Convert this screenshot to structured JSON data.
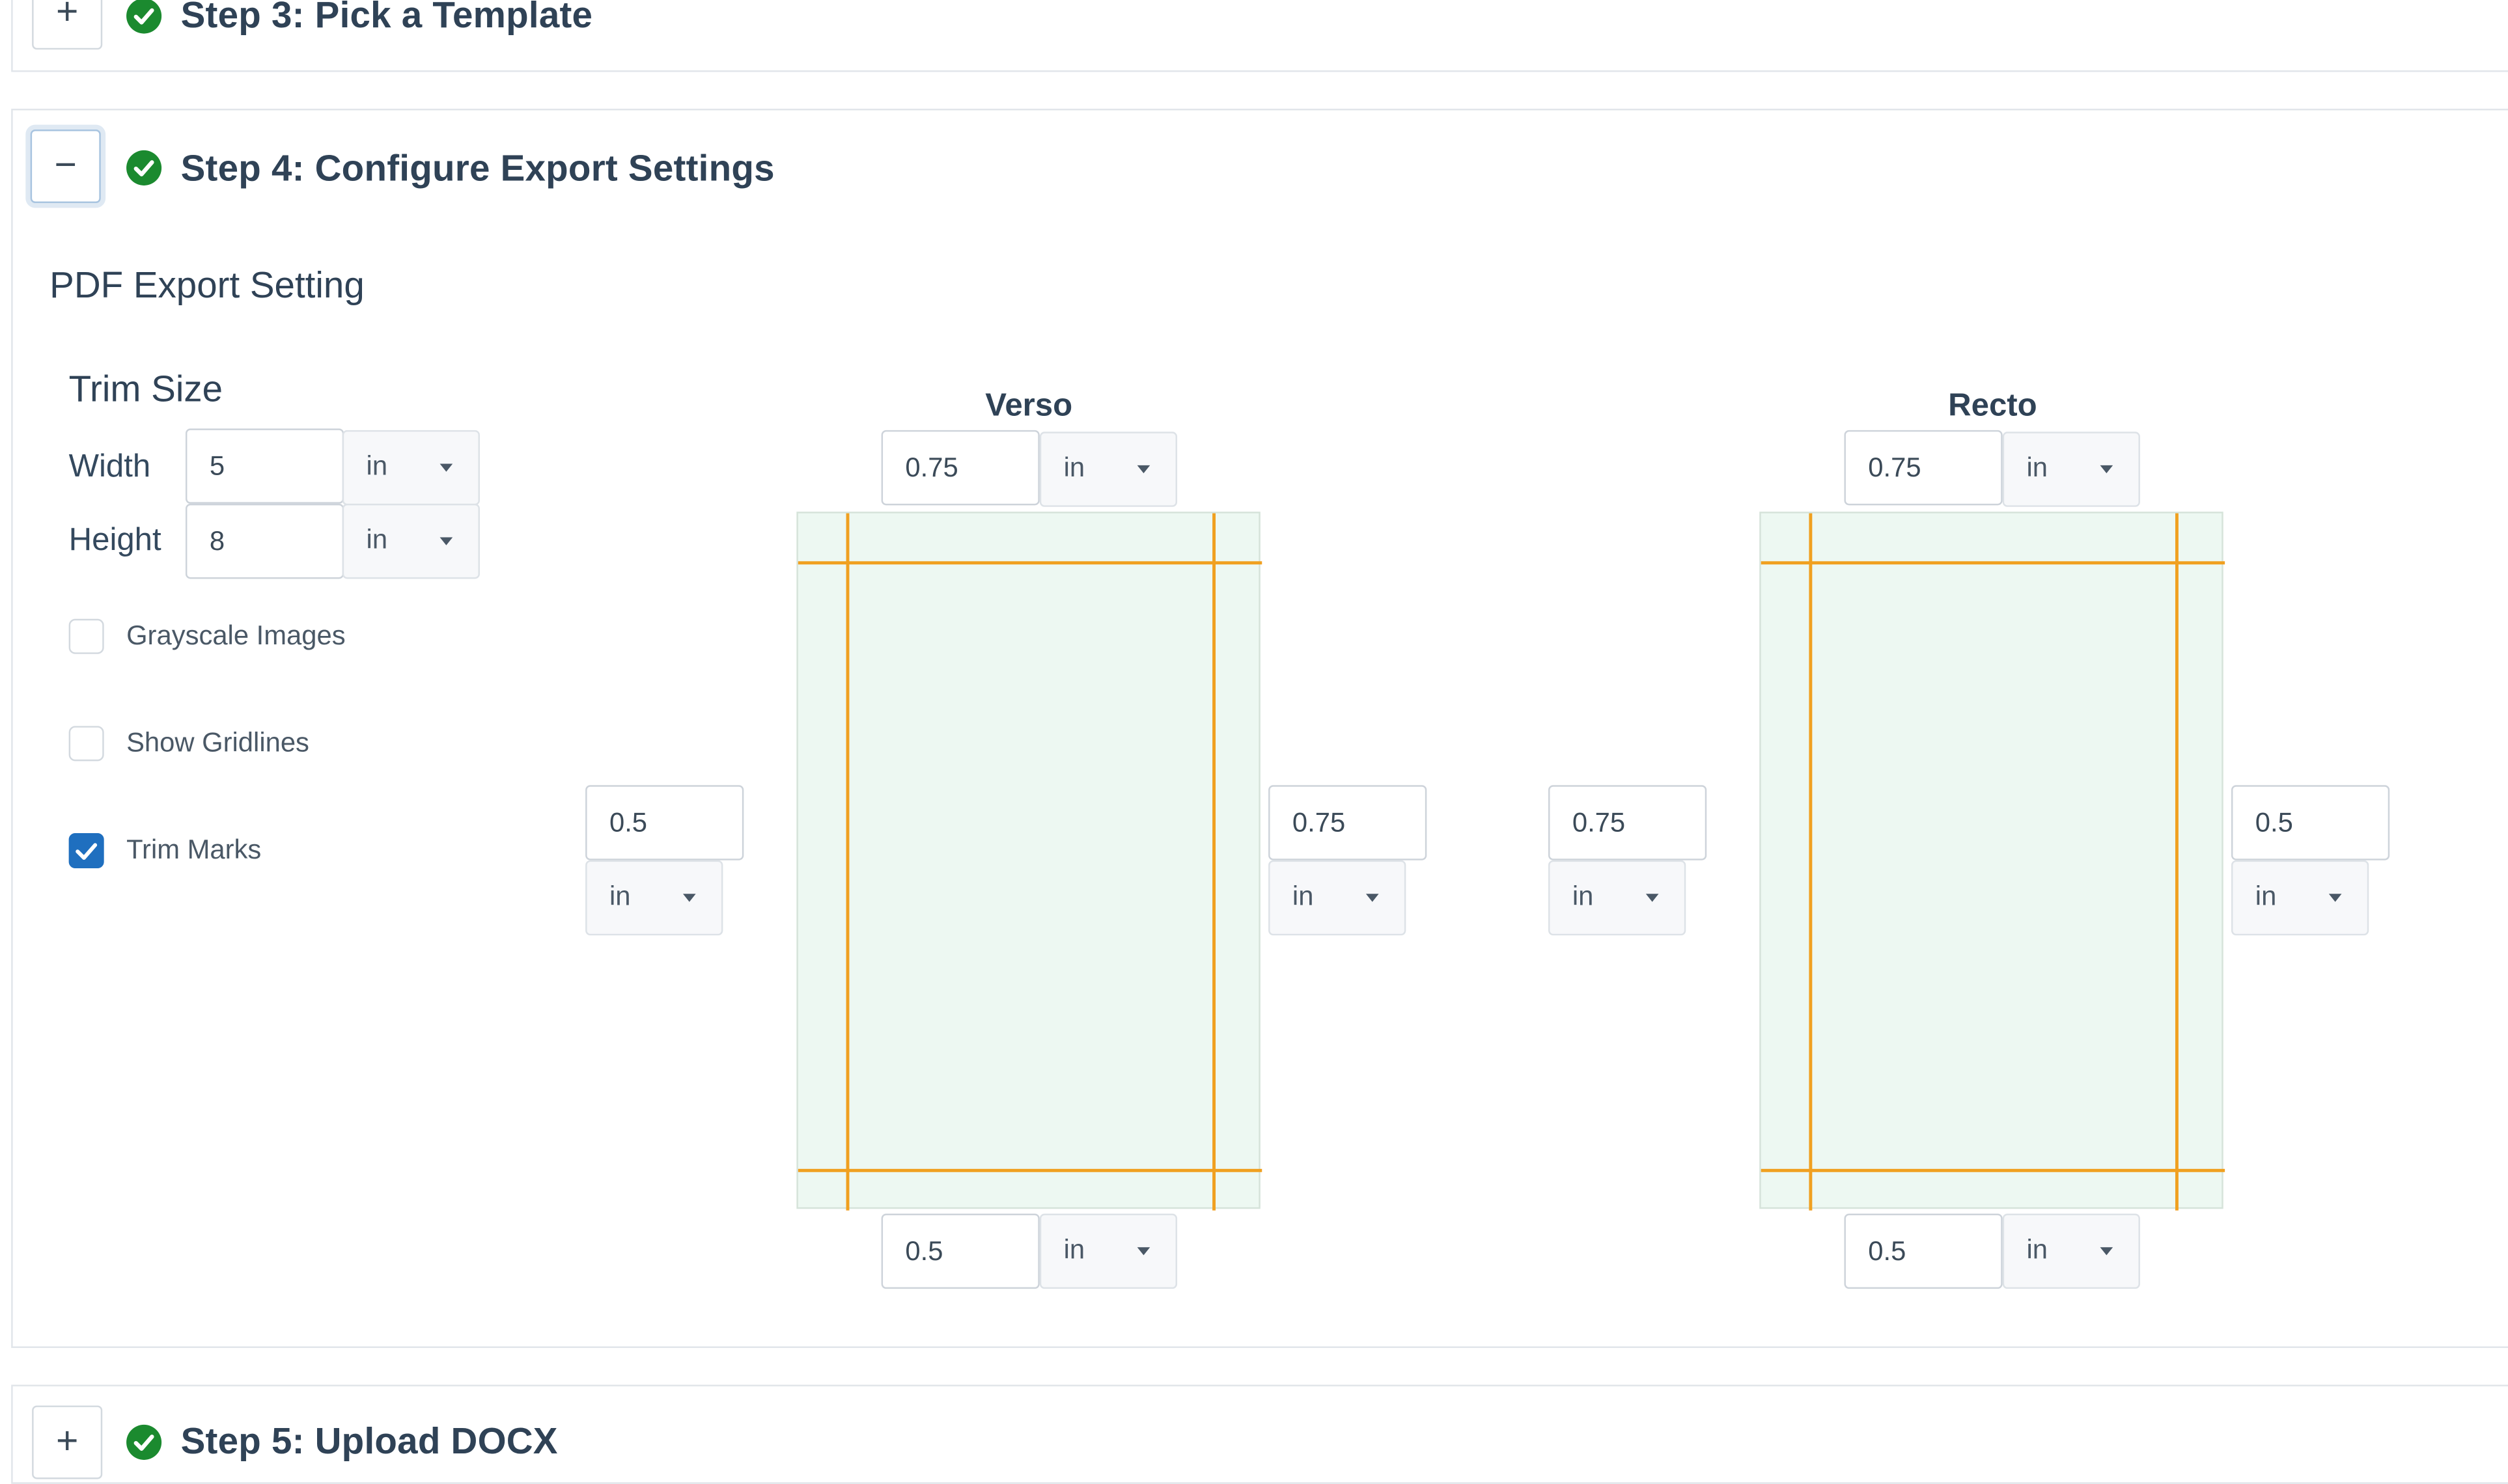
{
  "steps": {
    "step3": {
      "toggle": "+",
      "title": "Step 3: Pick a Template"
    },
    "step4": {
      "toggle": "−",
      "title": "Step 4: Configure Export Settings"
    },
    "step5": {
      "toggle": "+",
      "title": "Step 5: Upload DOCX"
    }
  },
  "pdf_export": {
    "title": "PDF Export Setting",
    "trim_size": {
      "heading": "Trim Size",
      "width_label": "Width",
      "width_value": "5",
      "width_unit": "in",
      "height_label": "Height",
      "height_value": "8",
      "height_unit": "in"
    },
    "options": {
      "grayscale_label": "Grayscale Images",
      "grayscale_checked": false,
      "gridlines_label": "Show Gridlines",
      "gridlines_checked": false,
      "trim_marks_label": "Trim Marks",
      "trim_marks_checked": true
    },
    "verso": {
      "heading": "Verso",
      "top": {
        "value": "0.75",
        "unit": "in"
      },
      "left": {
        "value": "0.5",
        "unit": "in"
      },
      "right": {
        "value": "0.75",
        "unit": "in"
      },
      "bottom": {
        "value": "0.5",
        "unit": "in"
      }
    },
    "recto": {
      "heading": "Recto",
      "top": {
        "value": "0.75",
        "unit": "in"
      },
      "left": {
        "value": "0.75",
        "unit": "in"
      },
      "right": {
        "value": "0.5",
        "unit": "in"
      },
      "bottom": {
        "value": "0.5",
        "unit": "in"
      }
    }
  },
  "colors": {
    "success_green": "#1b8a2f",
    "checkbox_blue": "#1f6fbf",
    "margin_guide_orange": "#f0a020",
    "page_fill": "#edf8f2"
  },
  "icons": {
    "step_status": "check-circle-icon",
    "unit_dropdown": "caret-down-icon"
  }
}
